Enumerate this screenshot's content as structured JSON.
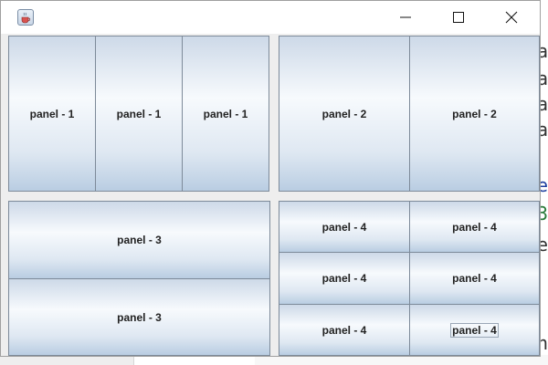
{
  "window": {
    "title": "",
    "controls": [
      "minimize",
      "maximize",
      "close"
    ]
  },
  "background": {
    "right_edge_chars": [
      "a",
      "a",
      "a",
      "a",
      "e",
      "3",
      "e",
      "n"
    ]
  },
  "panels": {
    "group1": [
      "panel - 1",
      "panel - 1",
      "panel - 1"
    ],
    "group2": [
      "panel - 2",
      "panel - 2"
    ],
    "group3": [
      "panel - 3",
      "panel - 3"
    ],
    "group4": [
      "panel - 4",
      "panel - 4",
      "panel - 4",
      "panel - 4",
      "panel - 4",
      "panel - 4"
    ]
  },
  "icons": {
    "app": "java-cup-icon",
    "minimize": "minimize-icon",
    "maximize": "maximize-icon",
    "close": "close-icon"
  }
}
